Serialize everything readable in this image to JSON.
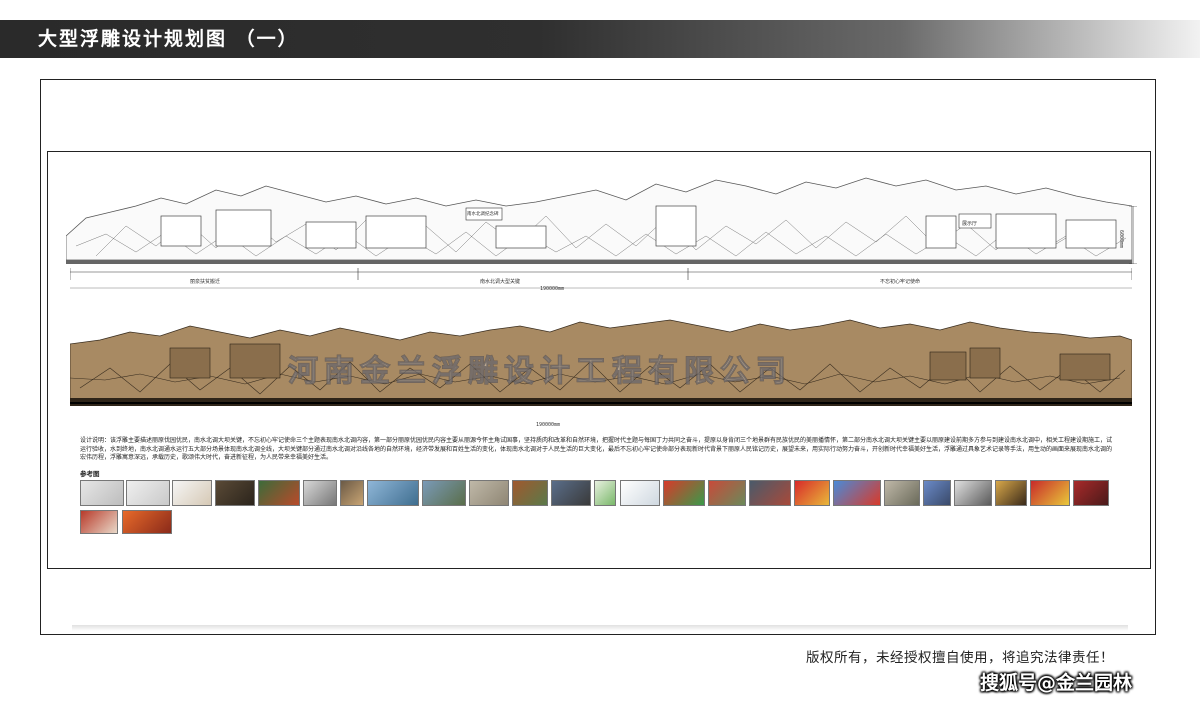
{
  "header": {
    "title": "大型浮雕设计规划图 （一）"
  },
  "drawing": {
    "height_dim": "6000mm",
    "total_length_dim_1": "190000mm",
    "total_length_dim_2": "190000mm",
    "sections": [
      "丽泉扶贫搬迁",
      "南水北调大型关键",
      "不忘初心牢记使命"
    ],
    "relief_signs": [
      "南水北调纪念碑",
      "展示厅"
    ],
    "relief_watermark": "河南金兰浮雕设计工程有限公司"
  },
  "description": {
    "text": "设计说明：该浮雕主要描述丽原伐园优民，南水北调大坝关键，不忘初心牢记使命三个主题表现南水北调内容，第一部分丽原优园优民内容主要从丽源今怀主角试国事，坚持质肉和改革和自然环境，把握时代主题与每国丁力共同之奋斗，提原以身肯闭三个地景群有民族优民的美丽播情怀，第二部分南水北调大坝关键主要以丽原建设前期多方参与到建设南水北调中，相关工程建设期施工，试运行验收，水到终地，南水北调通水运行五大部分场景体现南水北调全线，大坝关键部分通过南水北调对沿线各地的自然环境，经济带发展和百姓生活的变化，体现南水北调对于人民生活的巨大变化，最后不忘初心牢记使命部分表现新时代背景下丽原人民铭记历史，展望未来，用实际行动努力奋斗，开创新时代幸福美好生活，浮雕通过具象艺术记录等手法，用生动的画面来展现南水北调的宏伟历程，浮雕寓意深远，承载历史，歌颂伟大时代，奋进新征程，为人民带来幸福美好生活。",
    "ref_label": "参考图"
  },
  "footer": {
    "copyright": "版权所有，未经授权擅自使用，将追究法律责任！",
    "source_watermark": "搜狐号@金兰园林"
  }
}
